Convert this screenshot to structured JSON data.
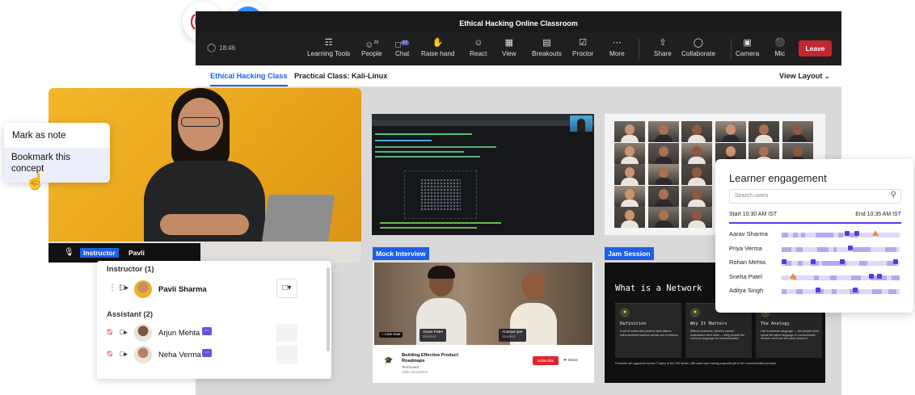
{
  "window": {
    "title": "Ethical Hacking Online Classroom",
    "time": "18:46"
  },
  "toolbar": {
    "items": [
      {
        "label": "Learning Tools",
        "icon": "learning-tools-icon"
      },
      {
        "label": "People",
        "icon": "people-icon",
        "badge": "26"
      },
      {
        "label": "Chat",
        "icon": "chat-icon",
        "badge": "17"
      },
      {
        "label": "Raise hand",
        "icon": "hand-icon"
      },
      {
        "label": "React",
        "icon": "smiley-icon"
      },
      {
        "label": "View",
        "icon": "view-icon"
      },
      {
        "label": "Breakouts",
        "icon": "breakouts-icon"
      },
      {
        "label": "Proctor",
        "icon": "proctor-icon"
      },
      {
        "label": "More",
        "icon": "more-icon"
      },
      {
        "label": "Share",
        "icon": "share-icon"
      },
      {
        "label": "Collaborate",
        "icon": "bulb-icon"
      },
      {
        "label": "Camera",
        "icon": "camera-icon"
      },
      {
        "label": "Mic",
        "icon": "mic-icon"
      }
    ],
    "leave": "Leave"
  },
  "tabs": {
    "class": "Ethical Hacking Class",
    "practical": "Practical Class: Kali-Linux",
    "view_layout": "View Layout"
  },
  "tiles": {
    "mock_interview": "Mock Interview",
    "jam_session": "Jam Session"
  },
  "video": {
    "live_now": "Live now",
    "name1": "Aryan Patel",
    "name2": "Ananya Iyer",
    "name1_role": "Student",
    "name2_role": "Student",
    "video_title": "Building Effective Product Roadmaps",
    "channel": "TechLearn",
    "subscribers": "100K subscribers",
    "subscribe": "Subscribe",
    "share": "Share"
  },
  "slide": {
    "title": "What is a Network",
    "cards": [
      {
        "heading": "Definition",
        "body": "A set of nodes that present have data to interconnected devices across one a network"
      },
      {
        "heading": "Why It Matters",
        "body": "Without protocols, devices cannot understand each other — they provide the common language for communication"
      },
      {
        "heading": "The Analogy",
        "body": "Like a common language — two people must speak the same language to communicate; devices need use the same protocol"
      }
    ],
    "footer": "Protocols are organized across 7 layers of the OSI Model, with each layer having a specific job in the communication process."
  },
  "context_menu": {
    "mark_note": "Mark as note",
    "bookmark": "Bookmark this concept"
  },
  "speaker": {
    "role": "Instructor",
    "name": "Pavli"
  },
  "people": {
    "instructor_header": "Instructor (1)",
    "instructor": "Pavli Sharma",
    "assistant_header": "Assistant (2)",
    "assistants": [
      "Arjun Mehta",
      "Neha Verma"
    ]
  },
  "engagement": {
    "title": "Learner engagement",
    "search_placeholder": "Search users",
    "start": "Start 10:30 AM IST",
    "end": "End 10:35 AM IST",
    "learners": [
      "Aarav Sharma",
      "Priya Verma",
      "Rohan Mehta",
      "Sneha Patel",
      "Aditya Singh"
    ]
  },
  "colors": {
    "accent": "#1d5fe8",
    "leave": "#c4262e",
    "live": "#e0262e",
    "zoom_blue": "#2d8cff",
    "engagement": "#4f3ee0"
  }
}
